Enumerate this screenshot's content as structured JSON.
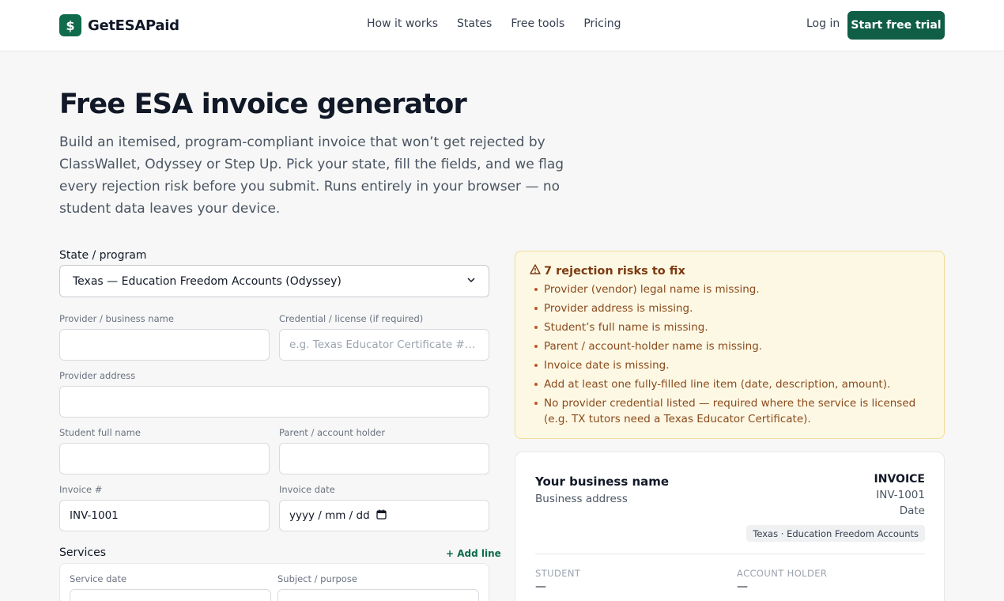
{
  "header": {
    "brand_icon": "$",
    "brand_name": "GetESAPaid",
    "nav": [
      "How it works",
      "States",
      "Free tools",
      "Pricing"
    ],
    "login": "Log in",
    "cta": "Start free trial"
  },
  "hero": {
    "title": "Free ESA invoice generator",
    "lead": "Build an itemised, program-compliant invoice that won’t get rejected by ClassWallet, Odyssey or Step Up. Pick your state, fill the fields, and we flag every rejection risk before you submit. Runs entirely in your browser — no student data leaves your device."
  },
  "form": {
    "state_label": "State / program",
    "state_value": "Texas — Education Freedom Accounts (Odyssey)",
    "provider_label": "Provider / business name",
    "provider_value": "",
    "credential_label": "Credential / license (if required)",
    "credential_placeholder": "e.g. Texas Educator Certificate #…",
    "address_label": "Provider address",
    "address_value": "",
    "student_label": "Student full name",
    "student_value": "",
    "parent_label": "Parent / account holder",
    "parent_value": "",
    "invoice_no_label": "Invoice #",
    "invoice_no_value": "INV-1001",
    "invoice_date_label": "Invoice date",
    "invoice_date_placeholder": "yyyy / mm / dd",
    "services_label": "Services",
    "add_line": "+ Add line",
    "service_date_label": "Service date",
    "subject_label": "Subject / purpose"
  },
  "risks": {
    "title": "7 rejection risks to fix",
    "items": [
      "Provider (vendor) legal name is missing.",
      "Provider address is missing.",
      "Student’s full name is missing.",
      "Parent / account-holder name is missing.",
      "Invoice date is missing.",
      "Add at least one fully-filled line item (date, description, amount).",
      "No provider credential listed — required where the service is licensed (e.g. TX tutors need a Texas Educator Certificate)."
    ]
  },
  "invoice": {
    "business_name": "Your business name",
    "business_address": "Business address",
    "heading": "INVOICE",
    "number": "INV-1001",
    "date": "Date",
    "program_badge": "Texas · Education Freedom Accounts",
    "student_caption": "STUDENT",
    "student_value": "—",
    "holder_caption": "ACCOUNT HOLDER",
    "holder_value": "—"
  },
  "colors": {
    "brand": "#0f6b4c",
    "cta": "#0f5e45",
    "risk_bg": "#fdf8e4",
    "risk_text": "#8a4a1c"
  }
}
